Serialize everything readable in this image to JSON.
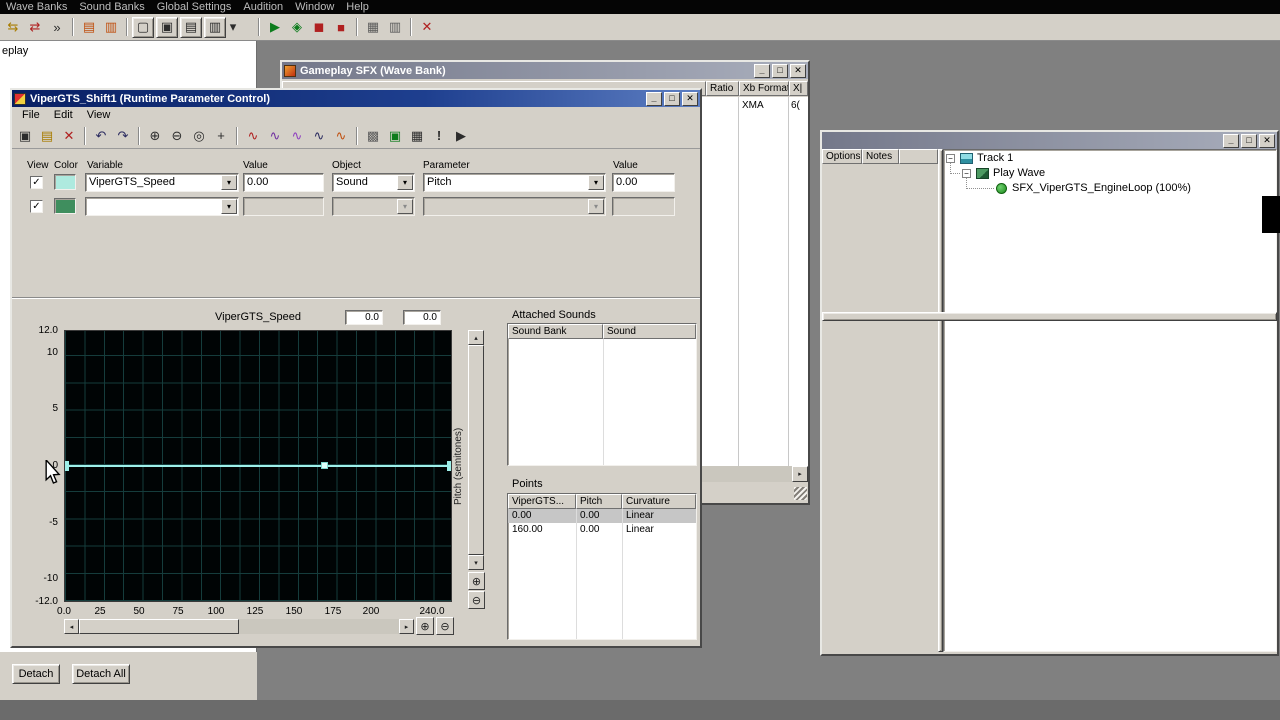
{
  "colors": {
    "row1_swatch": "#aeeadf",
    "row2_swatch": "#3f8e5e",
    "graph_line": "#9ef0ea",
    "selected_row_bg": "#c6c6c6"
  },
  "icons": {
    "main": [
      "⇆",
      "⇄",
      "»",
      "▤",
      "▥",
      "▢",
      "▣",
      "▤",
      "▥",
      "▾",
      "▶",
      "◈",
      "◼",
      "■",
      "▦",
      "▥",
      "✕"
    ],
    "rpc": [
      "▣",
      "▤",
      "✕",
      "↶",
      "↷",
      "⊕",
      "⊖",
      "◎",
      "+",
      "∿",
      "∿",
      "∿",
      "∿",
      "∿",
      "▩",
      "▣",
      "▦",
      "!",
      "▶"
    ],
    "arrows": {
      "up": "▴",
      "down": "▾",
      "left": "◂",
      "right": "▸"
    },
    "zoom_in": "⊕",
    "zoom_out": "⊖",
    "checkmark": "✓",
    "collapse": "−"
  },
  "chrome": {
    "minimize": "_",
    "maximize": "□",
    "close": "✕"
  },
  "menubar": {
    "items": [
      "Wave Banks",
      "Sound Banks",
      "Global Settings",
      "Audition",
      "Window",
      "Help"
    ]
  },
  "left_panel": {
    "clipped_text": "eplay",
    "detach": "Detach",
    "detach_all": "Detach All"
  },
  "wavebank_window": {
    "title": "Gameplay SFX (Wave Bank)",
    "columns": [
      "Ratio",
      "Xb Format",
      "X|"
    ],
    "row": {
      "xb_format": "XMA",
      "clipped": "6("
    }
  },
  "rpc_window": {
    "title": "ViperGTS_Shift1 (Runtime Parameter Control)",
    "menu": [
      "File",
      "Edit",
      "View"
    ],
    "form": {
      "headers": [
        "View",
        "Color",
        "Variable",
        "Value",
        "Object",
        "Parameter",
        "Value"
      ],
      "row1": {
        "variable": "ViperGTS_Speed",
        "value": "0.00",
        "object": "Sound",
        "parameter": "Pitch",
        "value2": "0.00"
      },
      "row2": {
        "variable": "",
        "value": "",
        "object": "",
        "parameter": "",
        "value2": ""
      }
    },
    "graph": {
      "title": "ViperGTS_Speed",
      "readouts": [
        "0.0",
        "0.0"
      ],
      "y_axis_label": "Pitch (semitones)",
      "y_ticks": [
        "12.0",
        "10",
        "5",
        "0",
        "-5",
        "-10",
        "-12.0"
      ],
      "x_ticks": [
        "0.0",
        "25",
        "50",
        "75",
        "100",
        "125",
        "150",
        "175",
        "200",
        "240.0"
      ]
    },
    "attached_sounds": {
      "title": "Attached Sounds",
      "columns": [
        "Sound Bank",
        "Sound"
      ]
    },
    "points": {
      "title": "Points",
      "columns": [
        "ViperGTS...",
        "Pitch",
        "Curvature"
      ],
      "rows": [
        [
          "0.00",
          "0.00",
          "Linear"
        ],
        [
          "160.00",
          "0.00",
          "Linear"
        ]
      ]
    }
  },
  "right_window": {
    "pane_headers": [
      "Options",
      "Notes"
    ],
    "tree": {
      "track": "Track 1",
      "play_wave": "Play Wave",
      "wave": "SFX_ViperGTS_EngineLoop (100%)"
    }
  },
  "chart_data": {
    "type": "line",
    "title": "ViperGTS_Speed",
    "xlabel": "ViperGTS_Speed",
    "ylabel": "Pitch (semitones)",
    "xlim": [
      0,
      240
    ],
    "ylim": [
      -12,
      12
    ],
    "x": [
      0,
      160
    ],
    "y": [
      0,
      0
    ],
    "curve_types": [
      "Linear",
      "Linear"
    ],
    "note": "flat line at 0 semitones extends across full x range",
    "legend_position": "none",
    "grid": true
  }
}
